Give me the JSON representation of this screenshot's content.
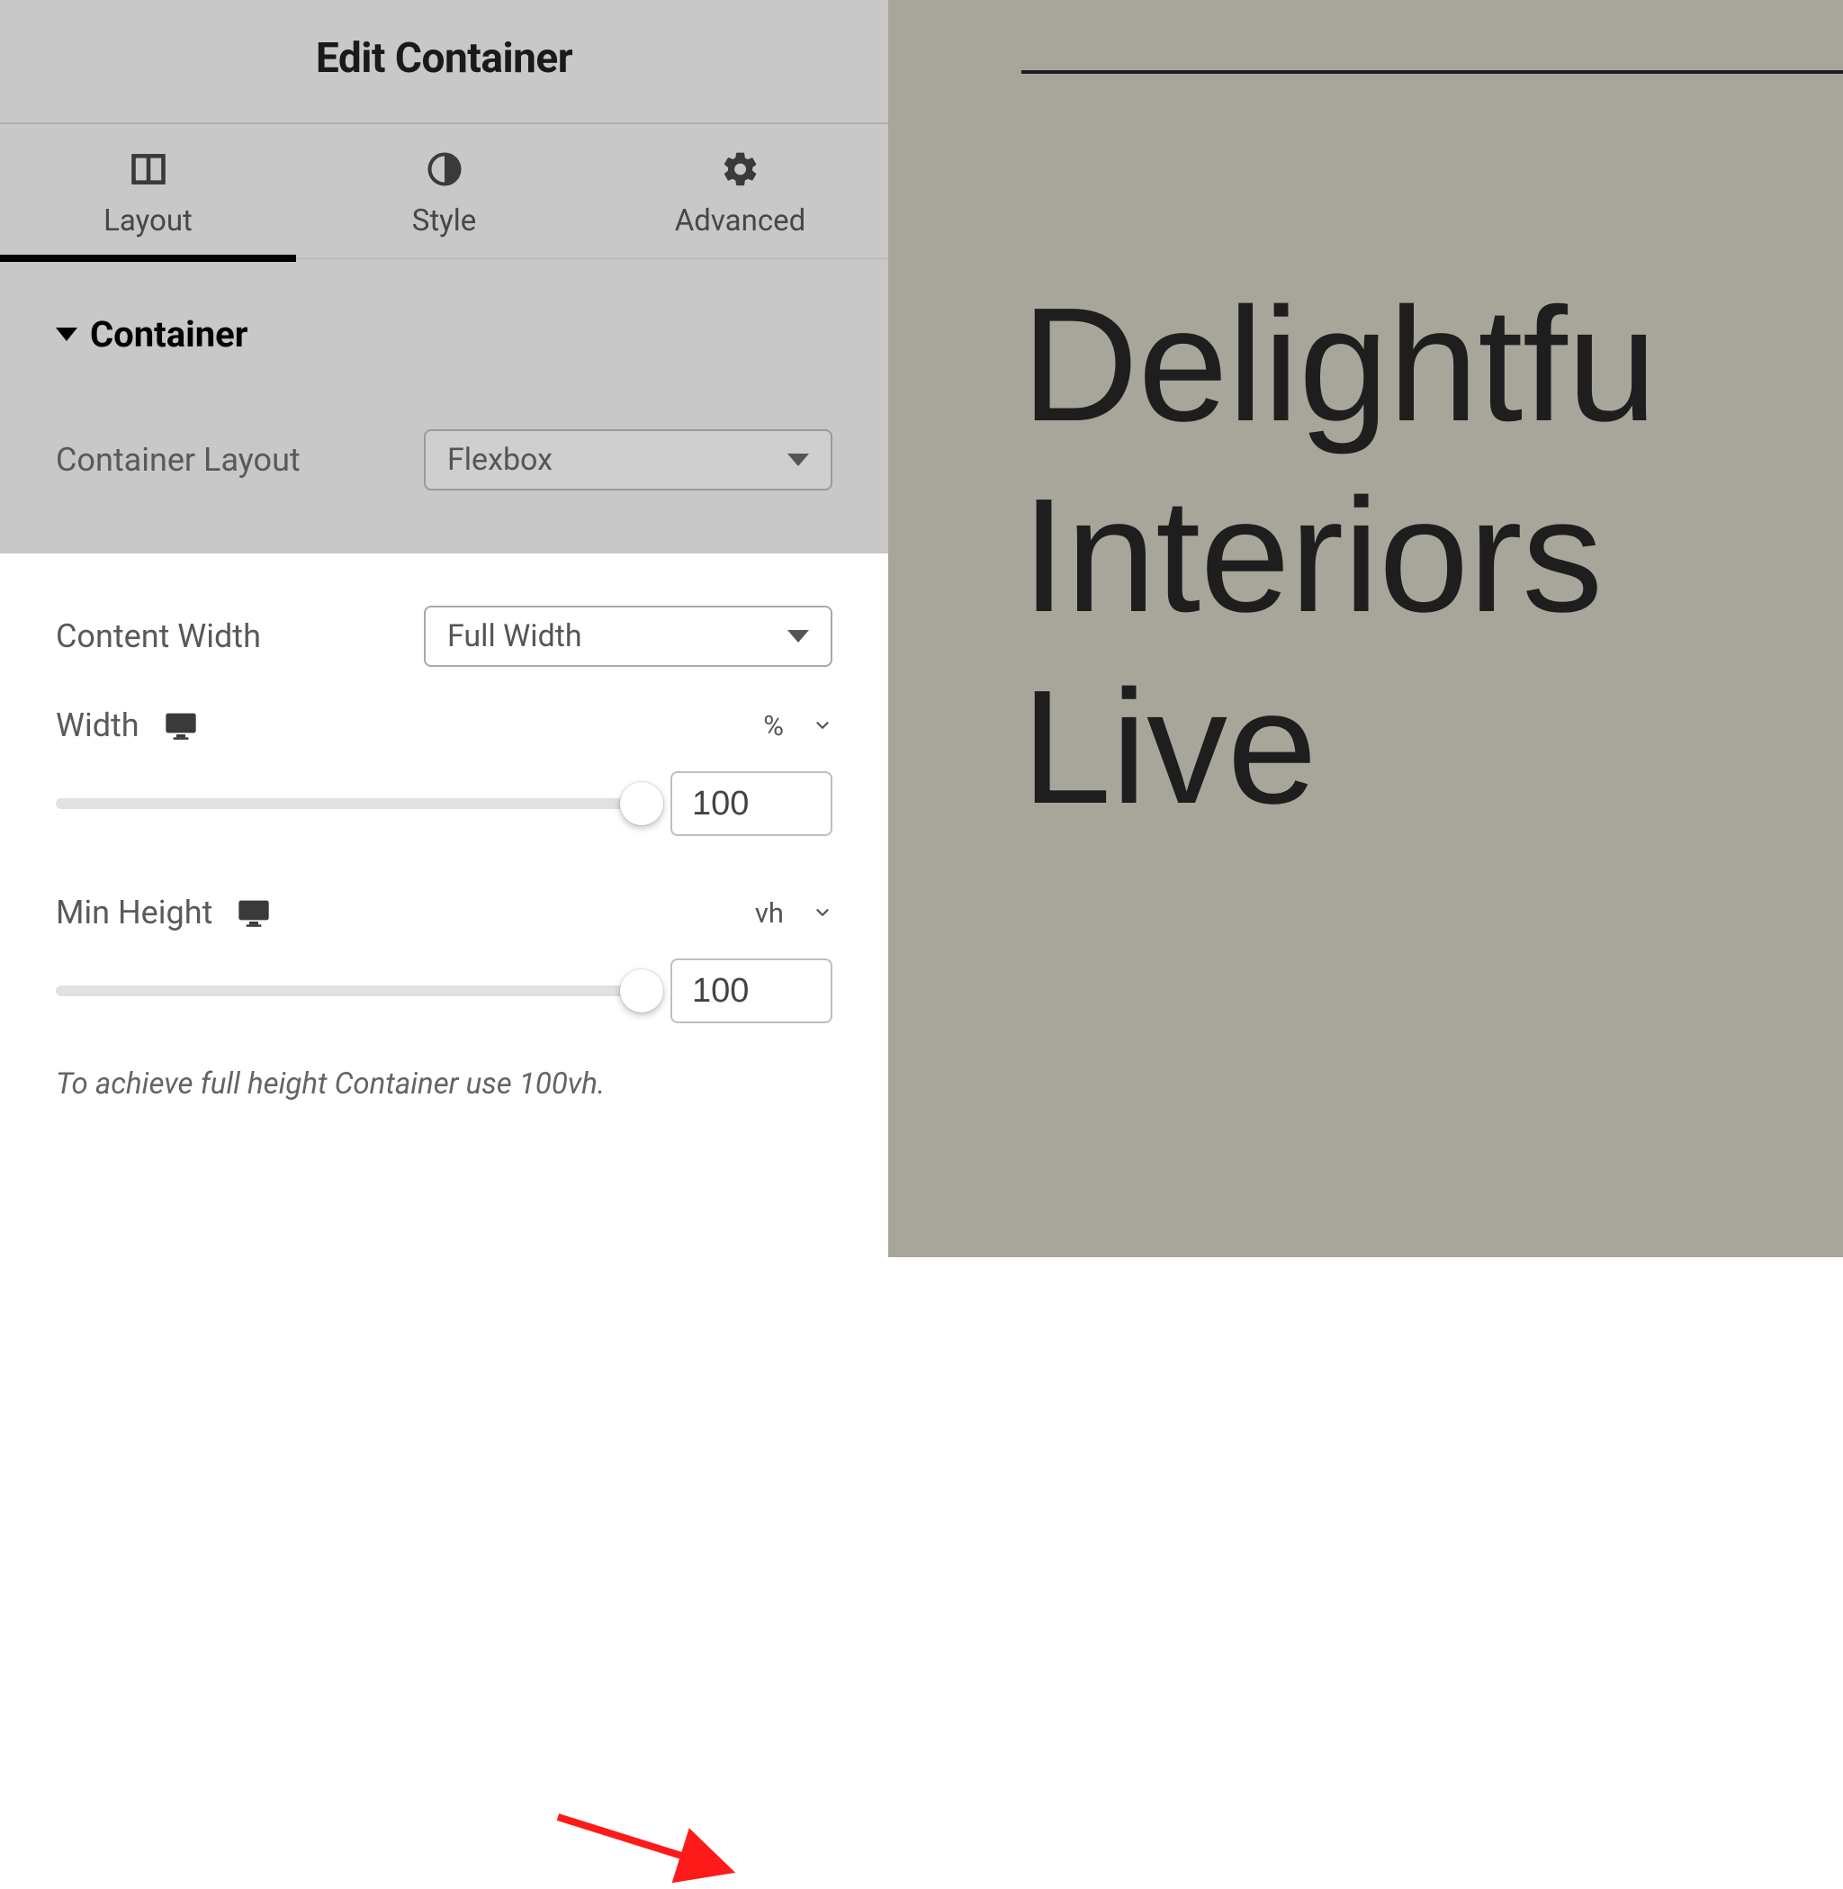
{
  "header": {
    "title": "Edit Container"
  },
  "tabs": {
    "layout": "Layout",
    "style": "Style",
    "advanced": "Advanced"
  },
  "section": {
    "title": "Container"
  },
  "controls": {
    "container_layout": {
      "label": "Container Layout",
      "value": "Flexbox"
    },
    "content_width": {
      "label": "Content Width",
      "value": "Full Width"
    },
    "width": {
      "label": "Width",
      "unit": "%",
      "value": "100"
    },
    "min_height": {
      "label": "Min Height",
      "unit": "vh",
      "value": "100"
    },
    "hint": "To achieve full height Container use 100vh."
  },
  "preview": {
    "heading": "Delightfu\nInteriors\nLive"
  },
  "colors": {
    "preview_bg": "#a8a69a",
    "arrow": "#ff1a1a"
  }
}
